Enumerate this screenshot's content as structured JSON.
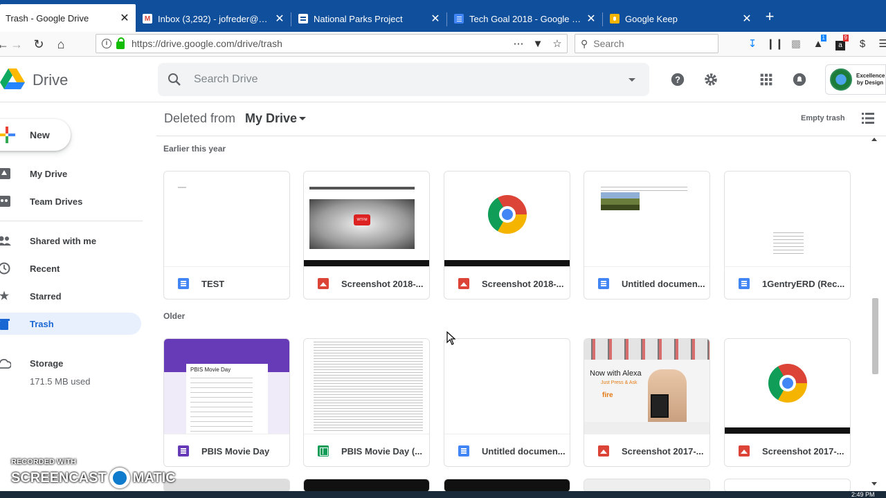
{
  "browser": {
    "tabs": [
      {
        "title": "Trash - Google Drive",
        "active": true
      },
      {
        "title": "Inbox (3,292) - jofreder@gmail.",
        "active": false
      },
      {
        "title": "National Parks Project",
        "active": false
      },
      {
        "title": "Tech Goal 2018 - Google Docs",
        "active": false
      },
      {
        "title": "Google Keep",
        "active": false
      }
    ],
    "close_glyph": "✕",
    "new_tab_glyph": "+",
    "url": "https://drive.google.com/drive/trash",
    "search_placeholder": "Search",
    "notification_badges": [
      "1",
      "9"
    ]
  },
  "drive": {
    "app_name": "Drive",
    "search_placeholder": "Search Drive",
    "account_label": "Excellence by Design",
    "new_button": "New",
    "nav": [
      {
        "label": "My Drive",
        "icon": "my-drive-icon"
      },
      {
        "label": "Team Drives",
        "icon": "team-drives-icon"
      },
      {
        "label": "Shared with me",
        "icon": "people-icon"
      },
      {
        "label": "Recent",
        "icon": "clock-icon"
      },
      {
        "label": "Starred",
        "icon": "star-icon"
      },
      {
        "label": "Trash",
        "icon": "trash-icon"
      }
    ],
    "storage": {
      "label": "Storage",
      "used": "171.5 MB used"
    },
    "breadcrumb": {
      "prefix": "Deleted from",
      "location": "My Drive"
    },
    "empty_trash": "Empty trash",
    "sections": [
      {
        "title": "Earlier this year",
        "files": [
          {
            "name": "TEST",
            "type": "doc"
          },
          {
            "name": "Screenshot 2018-...",
            "type": "image"
          },
          {
            "name": "Screenshot 2018-...",
            "type": "image"
          },
          {
            "name": "Untitled documen...",
            "type": "doc"
          },
          {
            "name": "1GentryERD (Rec...",
            "type": "doc"
          }
        ]
      },
      {
        "title": "Older",
        "files": [
          {
            "name": "PBIS Movie Day",
            "type": "form"
          },
          {
            "name": "PBIS Movie Day (...",
            "type": "sheet"
          },
          {
            "name": "Untitled documen...",
            "type": "doc"
          },
          {
            "name": "Screenshot 2017-...",
            "type": "image"
          },
          {
            "name": "Screenshot 2017-...",
            "type": "image"
          }
        ]
      }
    ],
    "thumb_text": {
      "form_title": "PBIS Movie Day",
      "ad_headline": "Now with Alexa",
      "ad_sub": "Just Press & Ask",
      "ad_brand": "fire",
      "video_label": "WTFM"
    }
  },
  "overlay": {
    "watermark_top": "RECORDED WITH",
    "watermark_left": "SCREENCAST",
    "watermark_right": "MATIC",
    "clock": "2:49 PM"
  },
  "colors": {
    "tabbar": "#0f4f9b",
    "active_nav_bg": "#e8f0fe",
    "active_nav_text": "#1967d2",
    "form_purple": "#673ab7"
  }
}
